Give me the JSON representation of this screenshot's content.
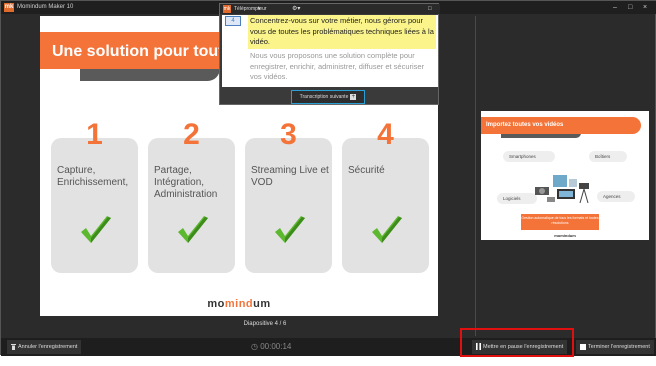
{
  "window": {
    "logo_text": "mk",
    "title": "Momindum Maker 10",
    "controls": [
      "–",
      "□",
      "×"
    ]
  },
  "slide": {
    "title": "Une solution pour toute",
    "cards": [
      {
        "number": "1",
        "text": "Capture, Enrichissement,"
      },
      {
        "number": "2",
        "text": "Partage, Intégration, Administration"
      },
      {
        "number": "3",
        "text": "Streaming Live et VOD"
      },
      {
        "number": "4",
        "text": "Sécurité"
      }
    ],
    "logo_pre": "mo",
    "logo_mid": "mind",
    "logo_post": "um"
  },
  "slide_counter": "Diapositive 4 / 6",
  "teleprompter": {
    "logo_text": "mk",
    "title": "Téléprompteur",
    "dropdown": "▾",
    "gear": "⚙▾",
    "maximize": "□",
    "paragraph_number": "4",
    "current_text": "Concentrez-vous sur votre métier, nous gérons pour vous de toutes les problématiques techniques liées à la vidéo.",
    "next_text": "Nous vous proposons une solution complète pour enregistrer, enrichir, administrer, diffuser et sécuriser vos vidéos.",
    "next_button": "Transcription suivante",
    "next_button_icon": "+"
  },
  "preview": {
    "title": "Importez toutes vos vidéos",
    "pills": [
      "Smartphones",
      "Boîtiers",
      "Logiciels",
      "Agences"
    ],
    "cta": "Gestion automatique de tous les formats et toutes résolutions",
    "logo": "momindum"
  },
  "bottombar": {
    "cancel_label": "Annuler l'enregistrement",
    "timer": "00:00:14",
    "pause_label": "Mettre en pause l'enregistrement",
    "finish_label": "Terminer l'enregistrement"
  },
  "colors": {
    "accent": "#f47338",
    "highlight_box": "#e01010",
    "teleprompter_highlight": "#fbf48a"
  }
}
